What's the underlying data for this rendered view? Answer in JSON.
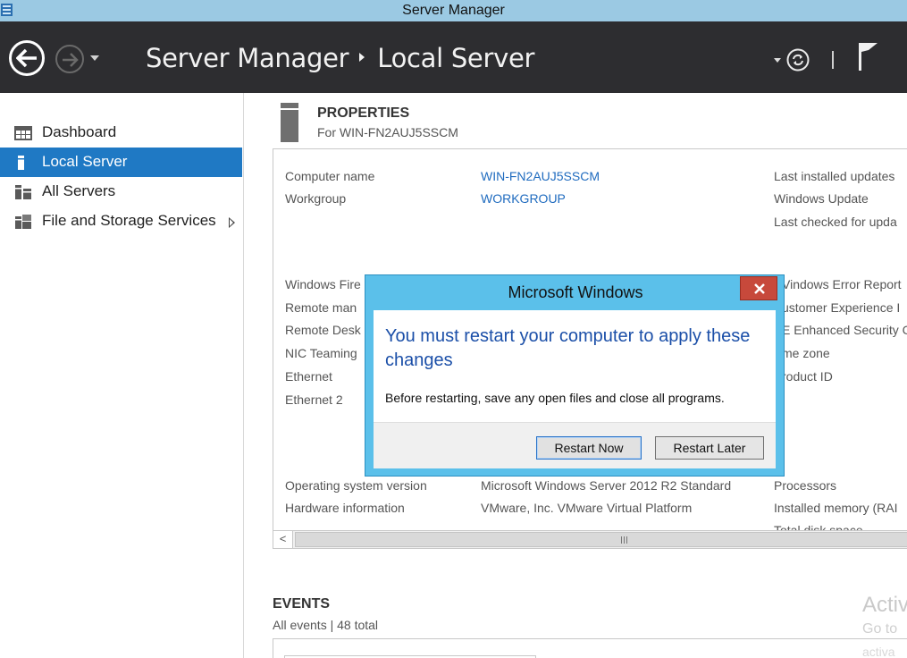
{
  "window": {
    "title": "Server Manager"
  },
  "header": {
    "breadcrumb_root": "Server Manager",
    "breadcrumb_current": "Local Server"
  },
  "sidebar": {
    "items": [
      {
        "label": "Dashboard",
        "icon": "dashboard-icon",
        "active": false
      },
      {
        "label": "Local Server",
        "icon": "server-icon",
        "active": true
      },
      {
        "label": "All Servers",
        "icon": "servers-icon",
        "active": false
      },
      {
        "label": "File and Storage Services",
        "icon": "storage-icon",
        "active": false,
        "has_submenu": true
      }
    ]
  },
  "properties": {
    "title": "PROPERTIES",
    "subtitle": "For WIN-FN2AUJ5SSCM",
    "left_labels": {
      "computer_name": "Computer name",
      "workgroup": "Workgroup",
      "windows_firewall": "Windows Fire",
      "remote_management": "Remote man",
      "remote_desktop": "Remote Desk",
      "nic_teaming": "NIC Teaming",
      "ethernet": "Ethernet",
      "ethernet2": "Ethernet 2",
      "os_version": "Operating system version",
      "hardware": "Hardware information"
    },
    "left_values": {
      "computer_name": "WIN-FN2AUJ5SSCM",
      "workgroup": "WORKGROUP",
      "os_version": "Microsoft Windows Server 2012 R2 Standard",
      "hardware": "VMware, Inc. VMware Virtual Platform"
    },
    "right_labels": {
      "last_installed": "Last installed updates",
      "windows_update": "Windows Update",
      "last_checked": "Last checked for upda",
      "error_reporting": "Vindows Error Report",
      "customer_experience": "ustomer Experience I",
      "ie_security": "E Enhanced Security C",
      "time_zone": "me zone",
      "product_id": "roduct ID",
      "processors": "Processors",
      "memory": "Installed memory (RAI",
      "disk": "Total disk space"
    }
  },
  "events": {
    "title": "EVENTS",
    "subtitle": "All events | 48 total"
  },
  "watermark": {
    "line1": "Activ",
    "line2": "Go to",
    "line3": "activa"
  },
  "dialog": {
    "title": "Microsoft Windows",
    "message": "You must restart your computer to apply these changes",
    "detail": "Before restarting, save any open files and close all programs.",
    "restart_now": "Restart Now",
    "restart_later": "Restart Later"
  },
  "colors": {
    "header_bg": "#2d2d30",
    "accent": "#1f79c4",
    "dialog_frame": "#5bc0ea",
    "link": "#1f6bbf",
    "close_button": "#c7493b"
  }
}
